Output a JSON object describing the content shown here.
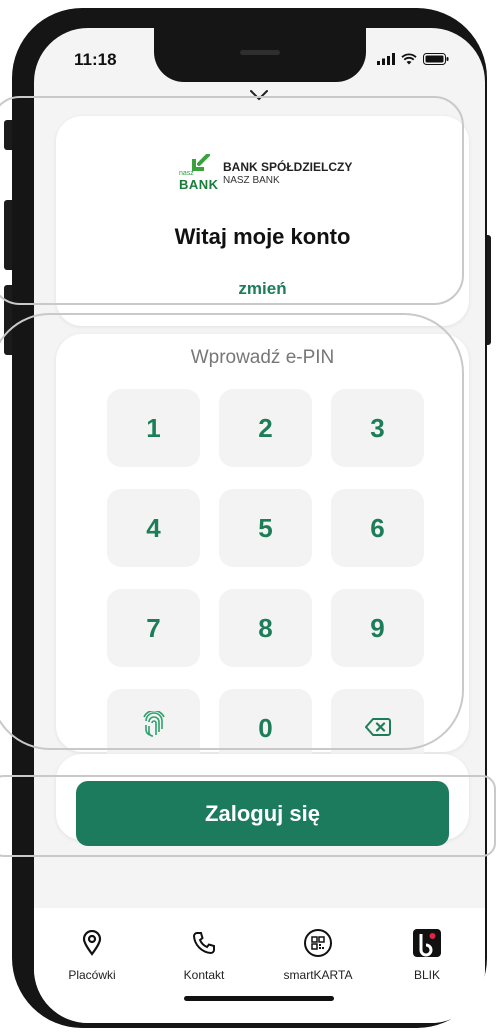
{
  "status_bar": {
    "time": "11:18"
  },
  "header": {
    "collapse_icon": "chevron-down-icon"
  },
  "account_card": {
    "logo_small": "nasz",
    "logo_big": "BANK",
    "bank_name_line1": "BANK SPÓŁDZIELCZY",
    "bank_name_line2": "NASZ BANK",
    "greeting": "Witaj moje konto",
    "change_link": "zmień"
  },
  "pin": {
    "label": "Wprowadź e-PIN",
    "keys": [
      "1",
      "2",
      "3",
      "4",
      "5",
      "6",
      "7",
      "8",
      "9",
      "0"
    ],
    "biometric_icon": "fingerprint-icon",
    "delete_icon": "backspace-icon"
  },
  "login_button": {
    "label": "Zaloguj się"
  },
  "bottom_nav": {
    "items": [
      {
        "label": "Placówki",
        "icon": "location-pin-icon"
      },
      {
        "label": "Kontakt",
        "icon": "phone-icon"
      },
      {
        "label": "smartKARTA",
        "icon": "qr-code-icon"
      },
      {
        "label": "BLIK",
        "icon": "blik-icon"
      }
    ]
  },
  "colors": {
    "accent": "#1d7b5d",
    "key_text": "#1c7d58",
    "key_bg": "#f3f3f3",
    "screen_bg": "#f4f4f4"
  }
}
